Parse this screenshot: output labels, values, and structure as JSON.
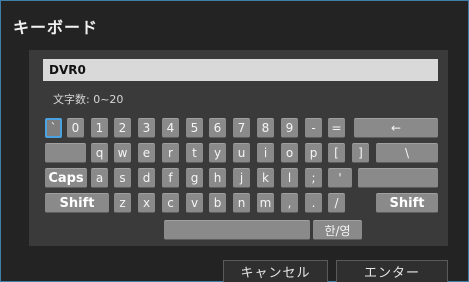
{
  "dialog": {
    "title": "キーボード",
    "input_value": "DVR0",
    "char_count_label": "文字数: 0~20",
    "cancel_label": "キャンセル",
    "enter_label": "エンター",
    "accent_color": "#3d7fa8"
  },
  "keyboard": {
    "row1": [
      "`",
      "0",
      "1",
      "2",
      "3",
      "4",
      "5",
      "6",
      "7",
      "8",
      "9",
      "-",
      "=",
      "←"
    ],
    "row2": [
      "",
      "q",
      "w",
      "e",
      "r",
      "t",
      "y",
      "u",
      "i",
      "o",
      "p",
      "[",
      "]",
      "\\"
    ],
    "row3": [
      "Caps",
      "a",
      "s",
      "d",
      "f",
      "g",
      "h",
      "j",
      "k",
      "l",
      ";",
      "'",
      ""
    ],
    "row4": [
      "Shift",
      "z",
      "x",
      "c",
      "v",
      "b",
      "n",
      "m",
      ",",
      ".",
      "/",
      "Shift"
    ],
    "row5": [
      "",
      "한/영"
    ]
  }
}
